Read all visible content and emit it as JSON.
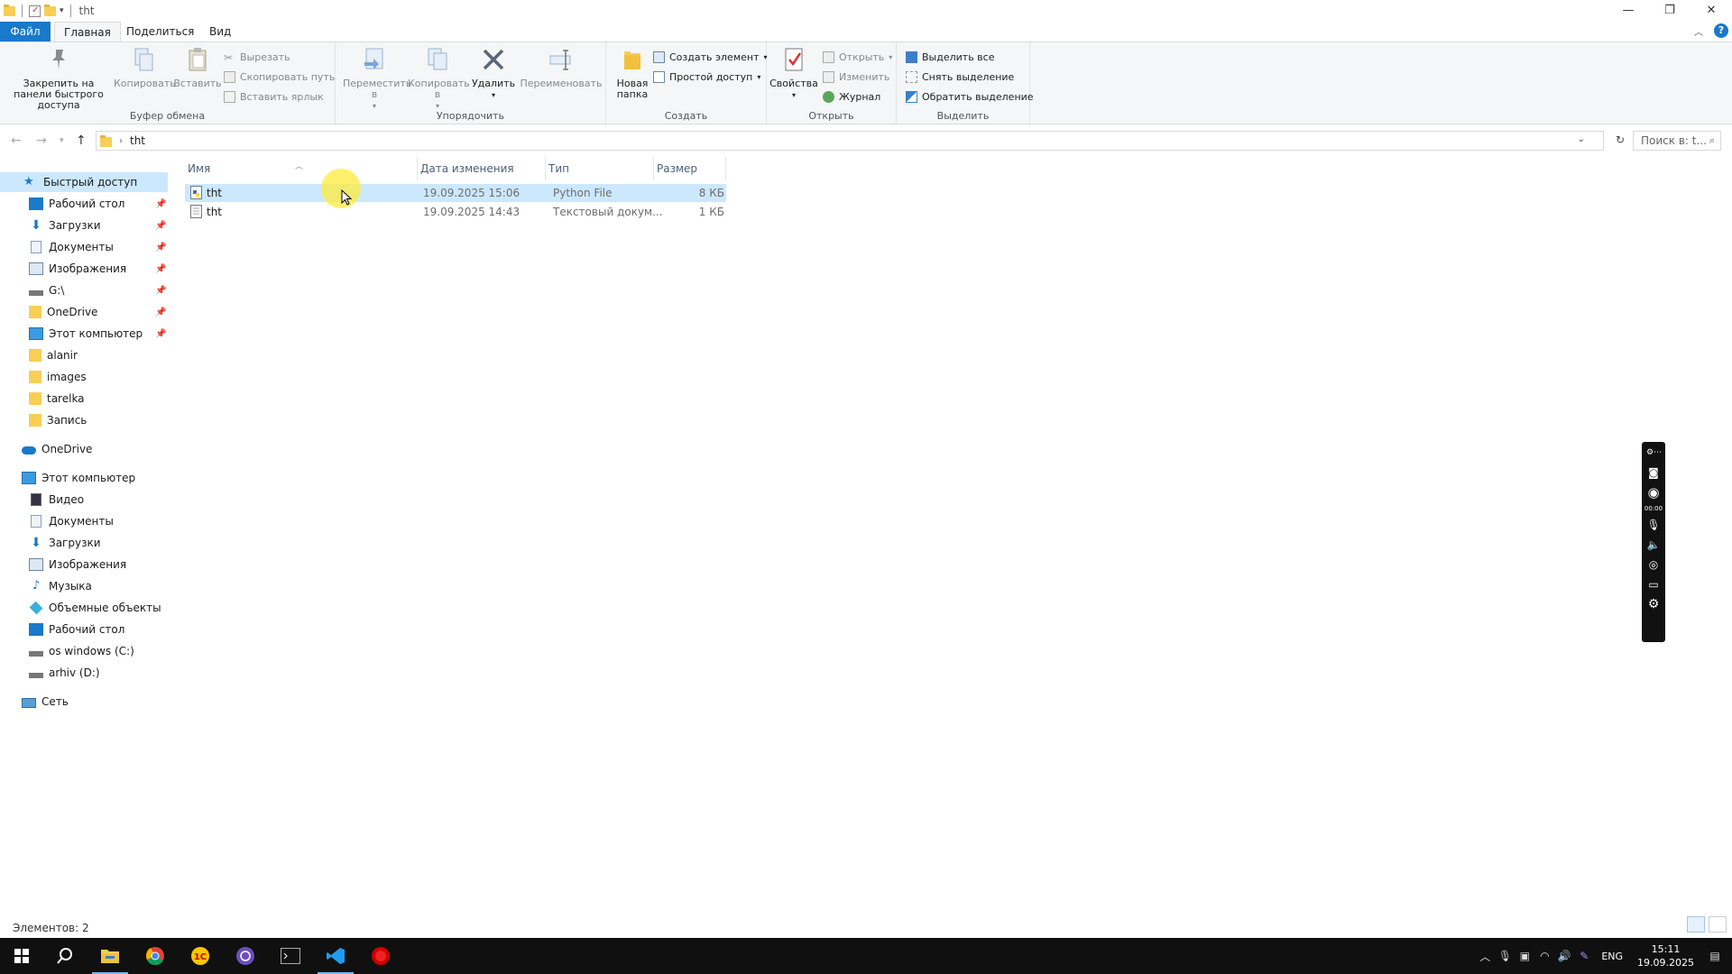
{
  "window": {
    "title": "tht",
    "controls": {
      "minimize": "—",
      "restore": "❐",
      "close": "✕"
    }
  },
  "ribbon_tabs": [
    {
      "label": "Файл"
    },
    {
      "label": "Главная"
    },
    {
      "label": "Поделиться"
    },
    {
      "label": "Вид"
    }
  ],
  "help": {
    "label": "?"
  },
  "ribbon": {
    "clipboard": {
      "label": "Буфер обмена",
      "pin_label": "Закрепить на панели быстрого доступа",
      "copy": "Копировать",
      "paste": "Вставить",
      "cut": "Вырезать",
      "copy_path": "Скопировать путь",
      "paste_shortcut": "Вставить ярлык"
    },
    "organize": {
      "label": "Упорядочить",
      "move_to": "Переместить в",
      "copy_to": "Копировать в",
      "delete": "Удалить",
      "rename": "Переименовать"
    },
    "create": {
      "label": "Создать",
      "new_folder": "Новая папка",
      "new_item": "Создать элемент",
      "easy_access": "Простой доступ"
    },
    "open": {
      "label": "Открыть",
      "properties": "Свойства",
      "open": "Открыть",
      "edit": "Изменить",
      "history": "Журнал"
    },
    "select": {
      "label": "Выделить",
      "select_all": "Выделить все",
      "select_none": "Снять выделение",
      "invert": "Обратить выделение"
    }
  },
  "address": {
    "path": "tht",
    "search_placeholder": "Поиск в: t..."
  },
  "sidebar": {
    "quick_access": "Быстрый доступ",
    "pinned": [
      {
        "label": "Рабочий стол",
        "icon": "desktop-icon"
      },
      {
        "label": "Загрузки",
        "icon": "downloads-icon"
      },
      {
        "label": "Документы",
        "icon": "documents-icon"
      },
      {
        "label": "Изображения",
        "icon": "pictures-icon"
      },
      {
        "label": "G:\\",
        "icon": "drive-icon"
      },
      {
        "label": "OneDrive",
        "icon": "folder-icon"
      },
      {
        "label": "Этот компьютер",
        "icon": "computer-icon"
      }
    ],
    "recent": [
      {
        "label": "alanir"
      },
      {
        "label": "images"
      },
      {
        "label": "tarelka"
      },
      {
        "label": "Запись"
      }
    ],
    "onedrive": "OneDrive",
    "this_pc": "Этот компьютер",
    "pc_items": [
      {
        "label": "Видео",
        "icon": "video-icon"
      },
      {
        "label": "Документы",
        "icon": "documents-icon"
      },
      {
        "label": "Загрузки",
        "icon": "downloads-icon"
      },
      {
        "label": "Изображения",
        "icon": "pictures-icon"
      },
      {
        "label": "Музыка",
        "icon": "music-icon"
      },
      {
        "label": "Объемные объекты",
        "icon": "3d-objects-icon"
      },
      {
        "label": "Рабочий стол",
        "icon": "desktop-icon"
      },
      {
        "label": "os windows (C:)",
        "icon": "drive-icon"
      },
      {
        "label": "arhiv (D:)",
        "icon": "drive-icon"
      }
    ],
    "network": "Сеть"
  },
  "columns": {
    "name": "Имя",
    "date": "Дата изменения",
    "type": "Тип",
    "size": "Размер"
  },
  "files": [
    {
      "name": "tht",
      "date": "19.09.2025 15:06",
      "type": "Python File",
      "size": "8 КБ",
      "selected": true
    },
    {
      "name": "tht",
      "date": "19.09.2025 14:43",
      "type": "Текстовый докум...",
      "size": "1 КБ",
      "selected": false
    }
  ],
  "status": {
    "items": "Элементов: 2"
  },
  "recorder": {
    "time": "00:00"
  },
  "tray": {
    "language": "ENG",
    "time": "15:11",
    "date": "19.09.2025"
  }
}
